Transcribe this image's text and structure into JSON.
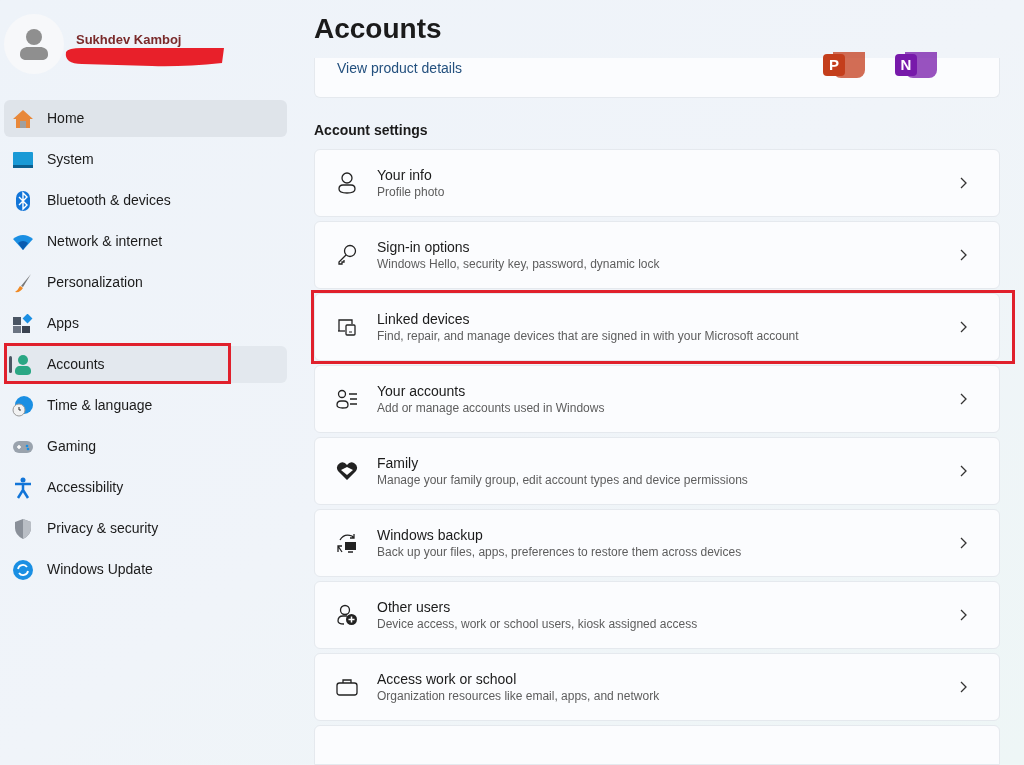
{
  "profile": {
    "name": "Sukhdev Kamboj",
    "redacted": true
  },
  "nav": [
    {
      "label": "Home",
      "selected": false,
      "hovered": true,
      "highlighted": false
    },
    {
      "label": "System",
      "selected": false,
      "hovered": false,
      "highlighted": false
    },
    {
      "label": "Bluetooth & devices",
      "selected": false,
      "hovered": false,
      "highlighted": false
    },
    {
      "label": "Network & internet",
      "selected": false,
      "hovered": false,
      "highlighted": false
    },
    {
      "label": "Personalization",
      "selected": false,
      "hovered": false,
      "highlighted": false
    },
    {
      "label": "Apps",
      "selected": false,
      "hovered": false,
      "highlighted": false
    },
    {
      "label": "Accounts",
      "selected": true,
      "hovered": false,
      "highlighted": true
    },
    {
      "label": "Time & language",
      "selected": false,
      "hovered": false,
      "highlighted": false
    },
    {
      "label": "Gaming",
      "selected": false,
      "hovered": false,
      "highlighted": false
    },
    {
      "label": "Accessibility",
      "selected": false,
      "hovered": false,
      "highlighted": false
    },
    {
      "label": "Privacy & security",
      "selected": false,
      "hovered": false,
      "highlighted": false
    },
    {
      "label": "Windows Update",
      "selected": false,
      "hovered": false,
      "highlighted": false
    }
  ],
  "page_title": "Accounts",
  "product_card": {
    "link": "View product details",
    "apps": [
      {
        "letter": "P",
        "color": "#c43e1c"
      },
      {
        "letter": "N",
        "color": "#7719aa"
      }
    ]
  },
  "section_title": "Account settings",
  "cards": [
    {
      "kind": "row",
      "title": "Your info",
      "subtitle": "Profile photo",
      "highlighted": false
    },
    {
      "kind": "row",
      "title": "Sign-in options",
      "subtitle": "Windows Hello, security key, password, dynamic lock",
      "highlighted": false
    },
    {
      "kind": "row",
      "title": "Linked devices",
      "subtitle": "Find, repair, and manage devices that are signed in with your Microsoft account",
      "highlighted": true
    },
    {
      "kind": "row",
      "title": "Your accounts",
      "subtitle": "Add or manage accounts used in Windows",
      "highlighted": false
    },
    {
      "kind": "row",
      "title": "Family",
      "subtitle": "Manage your family group, edit account types and device permissions",
      "highlighted": false
    },
    {
      "kind": "row",
      "title": "Windows backup",
      "subtitle": "Back up your files, apps, preferences to restore them across devices",
      "highlighted": false
    },
    {
      "kind": "row",
      "title": "Other users",
      "subtitle": "Device access, work or school users, kiosk assigned access",
      "highlighted": false
    },
    {
      "kind": "row",
      "title": "Access work or school",
      "subtitle": "Organization resources like email, apps, and network",
      "highlighted": false
    },
    {
      "kind": "cut"
    }
  ]
}
